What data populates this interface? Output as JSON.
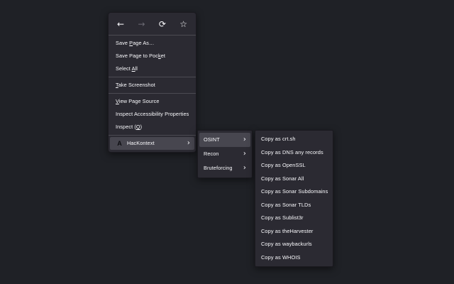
{
  "colors": {
    "page_bg": "#1f2126",
    "menu_bg": "#2b2a32",
    "menu_border": "#1a191f",
    "highlight": "#47464f",
    "text": "#fbfbfe",
    "disabled": "#6c6b74",
    "separator": "rgba(251,251,254,0.16)"
  },
  "toolbar": {
    "icons": [
      {
        "name": "back-icon",
        "glyph": "←",
        "enabled": true
      },
      {
        "name": "forward-icon",
        "glyph": "→",
        "enabled": false
      },
      {
        "name": "reload-icon",
        "glyph": "⟳",
        "enabled": true
      },
      {
        "name": "bookmark-star-icon",
        "glyph": "☆",
        "enabled": true
      }
    ]
  },
  "icon_glyphs": {
    "hackontext-logo": "A",
    "chevron-right": "›"
  },
  "main_menu": {
    "items": [
      {
        "type": "item",
        "label": "Save Page As…",
        "accesskey": "P"
      },
      {
        "type": "item",
        "label": "Save Page to Pocket",
        "accesskey": "k"
      },
      {
        "type": "item",
        "label": "Select All",
        "accesskey": "A"
      },
      {
        "type": "separator"
      },
      {
        "type": "item",
        "label": "Take Screenshot",
        "accesskey": "T"
      },
      {
        "type": "separator"
      },
      {
        "type": "item",
        "label": "View Page Source",
        "accesskey": "V"
      },
      {
        "type": "item",
        "label": "Inspect Accessibility Properties"
      },
      {
        "type": "item",
        "label": "Inspect (Q)",
        "accesskey": "Q"
      },
      {
        "type": "separator"
      },
      {
        "type": "item",
        "label": "HacKontext",
        "icon": "hackontext-logo",
        "submenu": true,
        "highlighted": true
      }
    ]
  },
  "hackontext_submenu": {
    "items": [
      {
        "type": "item",
        "label": "OSINT",
        "submenu": true,
        "highlighted": true
      },
      {
        "type": "item",
        "label": "Recon",
        "submenu": true
      },
      {
        "type": "item",
        "label": "Bruteforcing",
        "submenu": true
      }
    ]
  },
  "osint_submenu": {
    "items": [
      {
        "type": "item",
        "label": "Copy as crt.sh"
      },
      {
        "type": "item",
        "label": "Copy as DNS any records"
      },
      {
        "type": "item",
        "label": "Copy as OpenSSL"
      },
      {
        "type": "item",
        "label": "Copy as Sonar All"
      },
      {
        "type": "item",
        "label": "Copy as Sonar Subdomains"
      },
      {
        "type": "item",
        "label": "Copy as Sonar TLDs"
      },
      {
        "type": "item",
        "label": "Copy as Sublist3r"
      },
      {
        "type": "item",
        "label": "Copy as theHarvester"
      },
      {
        "type": "item",
        "label": "Copy as waybackurls"
      },
      {
        "type": "item",
        "label": "Copy as WHOIS"
      }
    ]
  }
}
